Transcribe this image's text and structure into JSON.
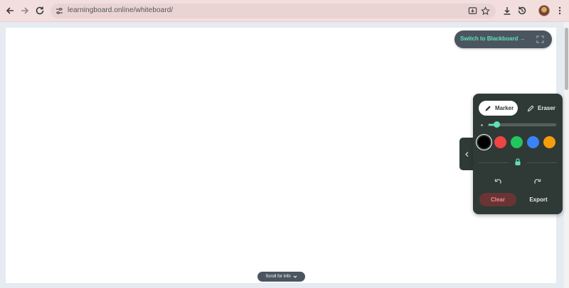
{
  "browser": {
    "url": "learningboard.online/whiteboard/"
  },
  "whiteboard": {
    "switch_label": "Switch to Blackboard →",
    "tools": {
      "marker_label": "Marker",
      "eraser_label": "Eraser",
      "active": "marker"
    },
    "brush_size": 0.12,
    "colors": [
      "#000000",
      "#ef4444",
      "#22c55e",
      "#3b82f6",
      "#f59e0b"
    ],
    "selected_color": "#000000",
    "clear_label": "Clear",
    "export_label": "Export",
    "accent": "#5fe3b4"
  },
  "scroll_hint": {
    "label": "Scroll for Info"
  }
}
